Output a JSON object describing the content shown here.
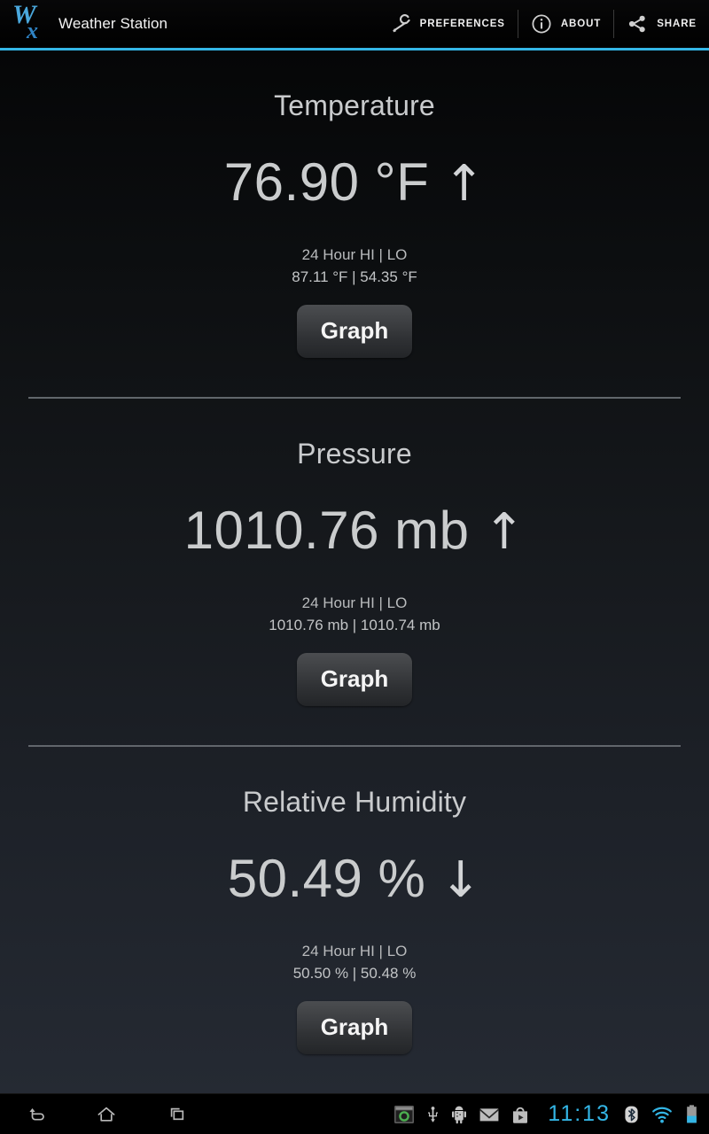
{
  "app": {
    "title": "Weather Station",
    "logo_main": "W",
    "logo_sub": "x",
    "accent_color": "#33b5e5"
  },
  "action_bar": {
    "items": [
      {
        "label": "PREFERENCES",
        "icon": "wrench-icon"
      },
      {
        "label": "ABOUT",
        "icon": "info-circle-icon"
      },
      {
        "label": "SHARE",
        "icon": "share-icon"
      }
    ]
  },
  "panels": [
    {
      "title": "Temperature",
      "value": "76.90 °F",
      "trend": "↑",
      "trend_name": "rising",
      "hilo_label": "24 Hour HI | LO",
      "hilo_values": "87.11 °F | 54.35 °F",
      "button_label": "Graph"
    },
    {
      "title": "Pressure",
      "value": "1010.76 mb",
      "trend": "↑",
      "trend_name": "rising",
      "hilo_label": "24 Hour HI | LO",
      "hilo_values": "1010.76 mb | 1010.74 mb",
      "button_label": "Graph"
    },
    {
      "title": "Relative Humidity",
      "value": "50.49 %",
      "trend": "↓",
      "trend_name": "falling",
      "hilo_label": "24 Hour HI | LO",
      "hilo_values": "50.50 % | 50.48 %",
      "button_label": "Graph"
    }
  ],
  "nav_bar": {
    "buttons": [
      {
        "name": "back-icon"
      },
      {
        "name": "home-icon"
      },
      {
        "name": "recents-icon"
      }
    ],
    "tray_icons": [
      "screenshot-icon",
      "usb-icon",
      "android-debug-icon",
      "gmail-icon",
      "play-store-icon"
    ],
    "clock": "11:13",
    "status_icons": [
      "bluetooth-icon",
      "wifi-icon",
      "battery-icon"
    ]
  }
}
